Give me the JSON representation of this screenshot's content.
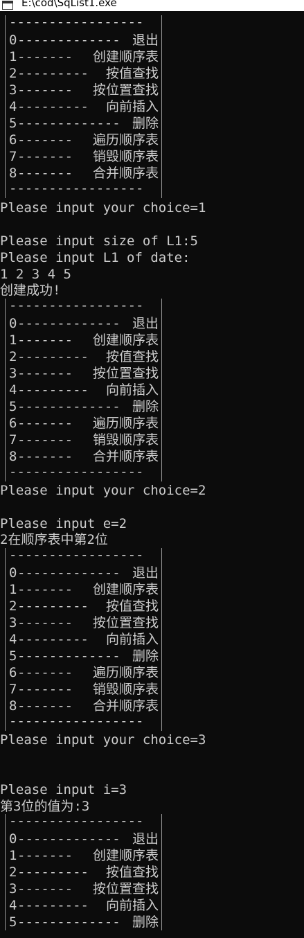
{
  "window": {
    "title": "E:\\cod\\SqList1.exe"
  },
  "menu": {
    "separator": "-----------------",
    "items": [
      {
        "num": "0",
        "dashes": "-------------",
        "label": "退出"
      },
      {
        "num": "1",
        "dashes": "-------",
        "label": "创建顺序表"
      },
      {
        "num": "2",
        "dashes": "---------",
        "label": "按值查找"
      },
      {
        "num": "3",
        "dashes": "-------",
        "label": "按位置查找"
      },
      {
        "num": "4",
        "dashes": "---------",
        "label": "向前插入"
      },
      {
        "num": "5",
        "dashes": "-------------",
        "label": "删除"
      },
      {
        "num": "6",
        "dashes": "-------",
        "label": "遍历顺序表"
      },
      {
        "num": "7",
        "dashes": "-------",
        "label": "销毁顺序表"
      },
      {
        "num": "8",
        "dashes": "-------",
        "label": "合并顺序表"
      }
    ]
  },
  "output": {
    "choice1": "Please input your choice=1",
    "size_prompt": "Please input size of L1:5",
    "data_prompt": "Please input L1 of date:",
    "data_values": "1 2 3 4 5",
    "create_success": "创建成功!",
    "choice2": "Please input your choice=2",
    "e_prompt": "Please input e=2",
    "find_result": "2在顺序表中第2位",
    "choice3": "Please input your choice=3",
    "i_prompt": "Please input i=3",
    "pos_result": "第3位的值为:3"
  }
}
